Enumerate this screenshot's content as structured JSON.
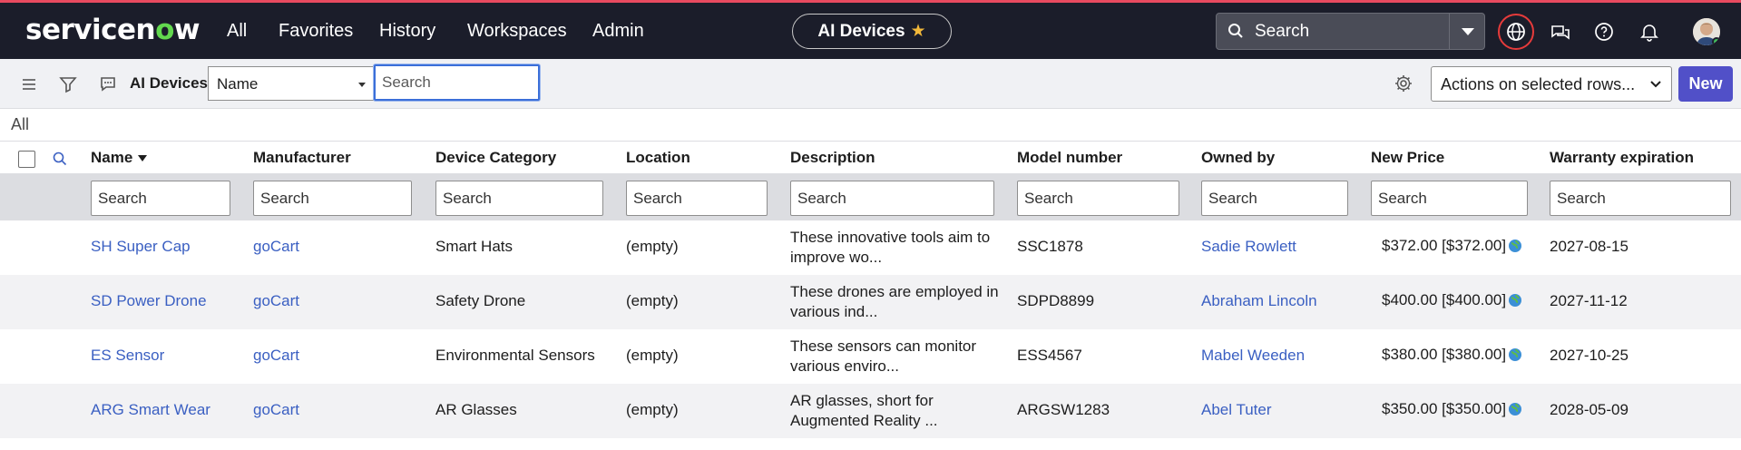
{
  "topbar": {
    "logo_main": "servicen",
    "logo_o": "o",
    "logo_end": "w",
    "nav": [
      "All",
      "Favorites",
      "History",
      "Workspaces",
      "Admin"
    ],
    "context_pill": "AI Devices",
    "search_placeholder": "Search"
  },
  "toolbar": {
    "title": "AI Devices",
    "field_select": "Name",
    "search_placeholder": "Search",
    "actions_select": "Actions on selected rows...",
    "new_label": "New"
  },
  "breadcrumb": "All",
  "columns": [
    "Name",
    "Manufacturer",
    "Device Category",
    "Location",
    "Description",
    "Model number",
    "Owned by",
    "New Price",
    "Warranty expiration"
  ],
  "filter_placeholder": "Search",
  "rows": [
    {
      "name": "SH Super Cap",
      "manufacturer": "goCart",
      "category": "Smart Hats",
      "location": "(empty)",
      "desc1": "These innovative tools aim to",
      "desc2": "improve wo...",
      "model": "SSC1878",
      "owner": "Sadie Rowlett",
      "price": "$372.00 [$372.00]",
      "warranty": "2027-08-15"
    },
    {
      "name": "SD Power Drone",
      "manufacturer": "goCart",
      "category": "Safety Drone",
      "location": "(empty)",
      "desc1": "These drones are employed in",
      "desc2": "various ind...",
      "model": "SDPD8899",
      "owner": "Abraham Lincoln",
      "price": "$400.00 [$400.00]",
      "warranty": "2027-11-12"
    },
    {
      "name": "ES Sensor",
      "manufacturer": "goCart",
      "category": "Environmental Sensors",
      "location": "(empty)",
      "desc1": "These sensors can monitor",
      "desc2": "various enviro...",
      "model": "ESS4567",
      "owner": "Mabel Weeden",
      "price": "$380.00 [$380.00]",
      "warranty": "2027-10-25"
    },
    {
      "name": "ARG Smart Wear",
      "manufacturer": "goCart",
      "category": "AR Glasses",
      "location": "(empty)",
      "desc1": "AR glasses, short for",
      "desc2": "Augmented Reality ...",
      "model": "ARGSW1283",
      "owner": "Abel Tuter",
      "price": "$350.00 [$350.00]",
      "warranty": "2028-05-09"
    }
  ],
  "colors": {
    "topbar": "#1b1d2a",
    "accent": "#5150c8",
    "link": "#3a5fc2",
    "logo_green": "#62d84e"
  }
}
